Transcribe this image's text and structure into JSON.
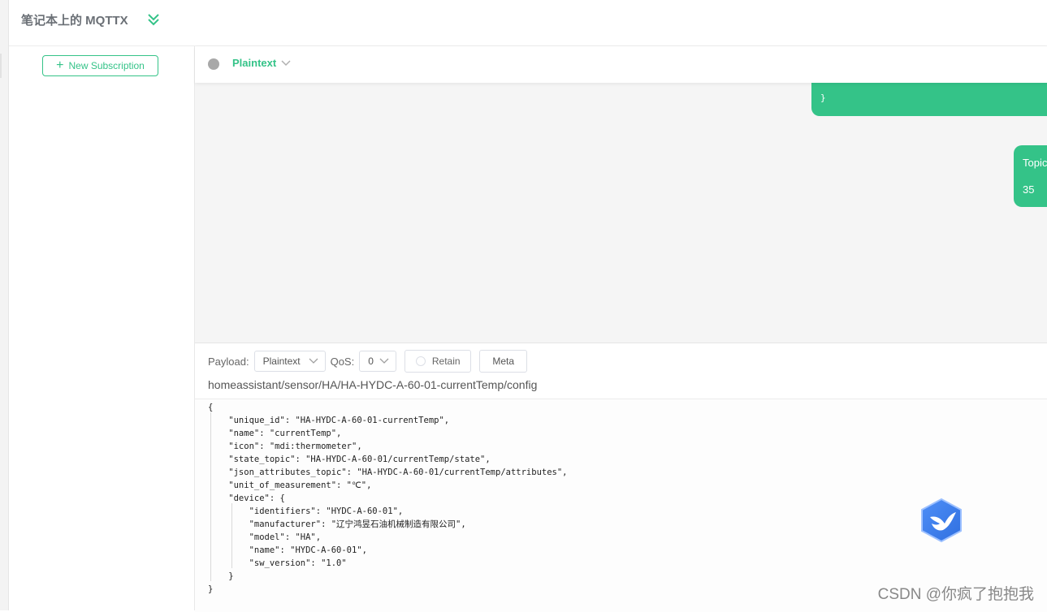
{
  "connection": {
    "title": "笔记本上的 MQTTX",
    "expand_icon": "double-chevron-down-icon"
  },
  "sidebar": {
    "new_subscription_label": "New Subscription",
    "plus_icon": "plus-icon"
  },
  "message_header": {
    "payload_filter": "Plaintext"
  },
  "messages": [
    {
      "direction": "out",
      "text": "}"
    },
    {
      "direction": "out",
      "topic_label": "Topic",
      "payload": "35"
    }
  ],
  "composer": {
    "payload_label": "Payload:",
    "payload_format": "Plaintext",
    "qos_label": "QoS:",
    "qos_value": "0",
    "retain_label": "Retain",
    "meta_label": "Meta",
    "topic": "homeassistant/sensor/HA/HA-HYDC-A-60-01-currentTemp/config",
    "payload_lines": [
      "{",
      "    \"unique_id\": \"HA-HYDC-A-60-01-currentTemp\",",
      "    \"name\": \"currentTemp\",",
      "    \"icon\": \"mdi:thermometer\",",
      "    \"state_topic\": \"HA-HYDC-A-60-01/currentTemp/state\",",
      "    \"json_attributes_topic\": \"HA-HYDC-A-60-01/currentTemp/attributes\",",
      "    \"unit_of_measurement\": \"℃\",",
      "    \"device\": {",
      "        \"identifiers\": \"HYDC-A-60-01\",",
      "        \"manufacturer\": \"辽宁鸿昱石油机械制造有限公司\",",
      "        \"model\": \"HA\",",
      "        \"name\": \"HYDC-A-60-01\",",
      "        \"sw_version\": \"1.0\"",
      "    }",
      "}"
    ]
  },
  "colors": {
    "accent": "#34c388",
    "status_dot": "#a8a8a8"
  },
  "watermark": "CSDN @你疯了抱抱我"
}
